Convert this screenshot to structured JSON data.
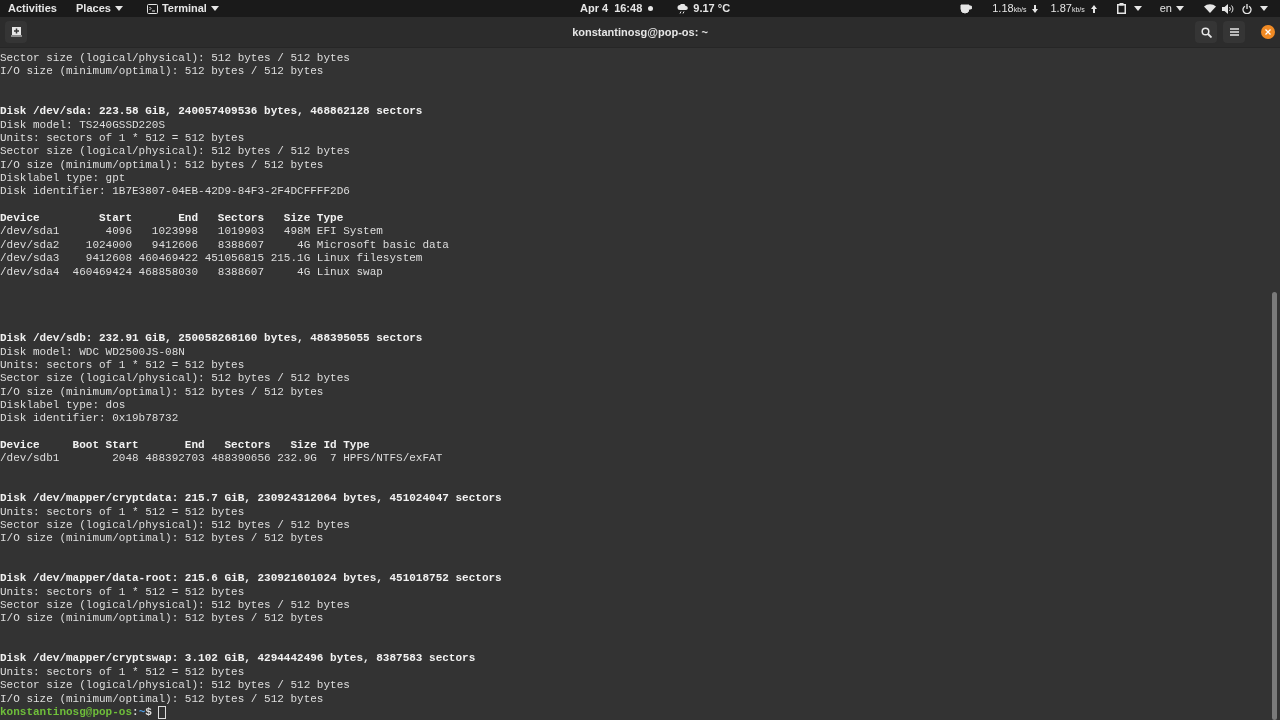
{
  "top_bar": {
    "activities": "Activities",
    "places": "Places",
    "app_menu": "Terminal",
    "date": "Apr 4",
    "time": "16:48",
    "weather": "9.17 °C",
    "net_down": {
      "value": "1.18",
      "unit": "kb/s"
    },
    "net_up": {
      "value": "1.87",
      "unit": "kb/s"
    },
    "language": "en"
  },
  "window": {
    "title": "konstantinosg@pop-os: ~"
  },
  "lines": [
    {
      "kind": "normal",
      "text": "Sector size (logical/physical): 512 bytes / 512 bytes"
    },
    {
      "kind": "normal",
      "text": "I/O size (minimum/optimal): 512 bytes / 512 bytes"
    },
    {
      "kind": "blank"
    },
    {
      "kind": "blank"
    },
    {
      "kind": "bold",
      "text": "Disk /dev/sda: 223.58 GiB, 240057409536 bytes, 468862128 sectors"
    },
    {
      "kind": "normal",
      "text": "Disk model: TS240GSSD220S"
    },
    {
      "kind": "normal",
      "text": "Units: sectors of 1 * 512 = 512 bytes"
    },
    {
      "kind": "normal",
      "text": "Sector size (logical/physical): 512 bytes / 512 bytes"
    },
    {
      "kind": "normal",
      "text": "I/O size (minimum/optimal): 512 bytes / 512 bytes"
    },
    {
      "kind": "normal",
      "text": "Disklabel type: gpt"
    },
    {
      "kind": "normal",
      "text": "Disk identifier: 1B7E3807-04EB-42D9-84F3-2F4DCFFFF2D6"
    },
    {
      "kind": "blank"
    },
    {
      "kind": "bold",
      "text": "Device         Start       End   Sectors   Size Type"
    },
    {
      "kind": "normal",
      "text": "/dev/sda1       4096   1023998   1019903   498M EFI System"
    },
    {
      "kind": "normal",
      "text": "/dev/sda2    1024000   9412606   8388607     4G Microsoft basic data"
    },
    {
      "kind": "normal",
      "text": "/dev/sda3    9412608 460469422 451056815 215.1G Linux filesystem"
    },
    {
      "kind": "normal",
      "text": "/dev/sda4  460469424 468858030   8388607     4G Linux swap"
    },
    {
      "kind": "blank"
    },
    {
      "kind": "blank"
    },
    {
      "kind": "blank"
    },
    {
      "kind": "blank"
    },
    {
      "kind": "bold",
      "text": "Disk /dev/sdb: 232.91 GiB, 250058268160 bytes, 488395055 sectors"
    },
    {
      "kind": "normal",
      "text": "Disk model: WDC WD2500JS-08N"
    },
    {
      "kind": "normal",
      "text": "Units: sectors of 1 * 512 = 512 bytes"
    },
    {
      "kind": "normal",
      "text": "Sector size (logical/physical): 512 bytes / 512 bytes"
    },
    {
      "kind": "normal",
      "text": "I/O size (minimum/optimal): 512 bytes / 512 bytes"
    },
    {
      "kind": "normal",
      "text": "Disklabel type: dos"
    },
    {
      "kind": "normal",
      "text": "Disk identifier: 0x19b78732"
    },
    {
      "kind": "blank"
    },
    {
      "kind": "bold",
      "text": "Device     Boot Start       End   Sectors   Size Id Type"
    },
    {
      "kind": "normal",
      "text": "/dev/sdb1        2048 488392703 488390656 232.9G  7 HPFS/NTFS/exFAT"
    },
    {
      "kind": "blank"
    },
    {
      "kind": "blank"
    },
    {
      "kind": "bold",
      "text": "Disk /dev/mapper/cryptdata: 215.7 GiB, 230924312064 bytes, 451024047 sectors"
    },
    {
      "kind": "normal",
      "text": "Units: sectors of 1 * 512 = 512 bytes"
    },
    {
      "kind": "normal",
      "text": "Sector size (logical/physical): 512 bytes / 512 bytes"
    },
    {
      "kind": "normal",
      "text": "I/O size (minimum/optimal): 512 bytes / 512 bytes"
    },
    {
      "kind": "blank"
    },
    {
      "kind": "blank"
    },
    {
      "kind": "bold",
      "text": "Disk /dev/mapper/data-root: 215.6 GiB, 230921601024 bytes, 451018752 sectors"
    },
    {
      "kind": "normal",
      "text": "Units: sectors of 1 * 512 = 512 bytes"
    },
    {
      "kind": "normal",
      "text": "Sector size (logical/physical): 512 bytes / 512 bytes"
    },
    {
      "kind": "normal",
      "text": "I/O size (minimum/optimal): 512 bytes / 512 bytes"
    },
    {
      "kind": "blank"
    },
    {
      "kind": "blank"
    },
    {
      "kind": "bold",
      "text": "Disk /dev/mapper/cryptswap: 3.102 GiB, 4294442496 bytes, 8387583 sectors"
    },
    {
      "kind": "normal",
      "text": "Units: sectors of 1 * 512 = 512 bytes"
    },
    {
      "kind": "normal",
      "text": "Sector size (logical/physical): 512 bytes / 512 bytes"
    },
    {
      "kind": "normal",
      "text": "I/O size (minimum/optimal): 512 bytes / 512 bytes"
    }
  ],
  "prompt": {
    "user_host": "konstantinosg@pop-os",
    "separator": ":",
    "path": "~",
    "symbol": "$"
  }
}
